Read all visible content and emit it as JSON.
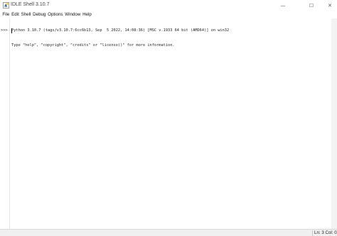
{
  "window": {
    "title": "IDLE Shell 3.10.7",
    "controls": {
      "minimize": "—",
      "maximize": "☐",
      "close": "✕"
    }
  },
  "menubar": {
    "items": [
      "File",
      "Edit",
      "Shell",
      "Debug",
      "Options",
      "Window",
      "Help"
    ]
  },
  "shell": {
    "lines": [
      "Python 3.10.7 (tags/v3.10.7:6cc6b13, Sep  5 2022, 14:08:36) [MSC v.1933 64 bit (AMD64)] on win32",
      "Type \"help\", \"copyright\", \"credits\" or \"license()\" for more information."
    ],
    "prompt": ">>>"
  },
  "statusbar": {
    "position": "Ln: 3  Col: 0"
  },
  "icons": {
    "app": "idle-app-icon"
  }
}
